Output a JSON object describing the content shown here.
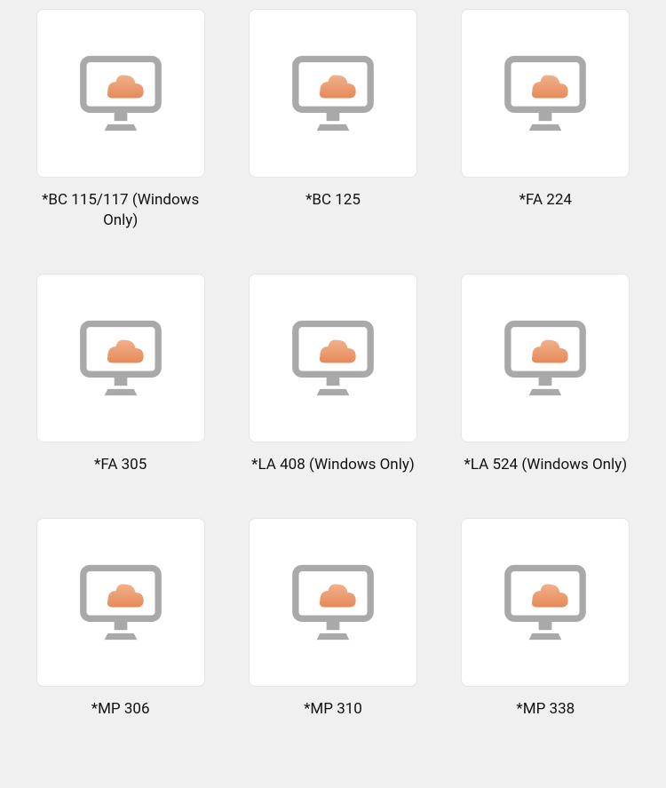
{
  "items": [
    {
      "label": "*BC 115/117 (Windows Only)"
    },
    {
      "label": "*BC 125"
    },
    {
      "label": "*FA 224"
    },
    {
      "label": "*FA 305"
    },
    {
      "label": "*LA 408 (Windows Only)"
    },
    {
      "label": "*LA 524 (Windows Only)"
    },
    {
      "label": "*MP 306"
    },
    {
      "label": "*MP 310"
    },
    {
      "label": "*MP 338"
    }
  ],
  "colors": {
    "monitor_stroke": "#a9a9a9",
    "monitor_fill": "#a9a9a9",
    "cloud_grad_top": "#f2b08a",
    "cloud_grad_bottom": "#e58a5a"
  }
}
